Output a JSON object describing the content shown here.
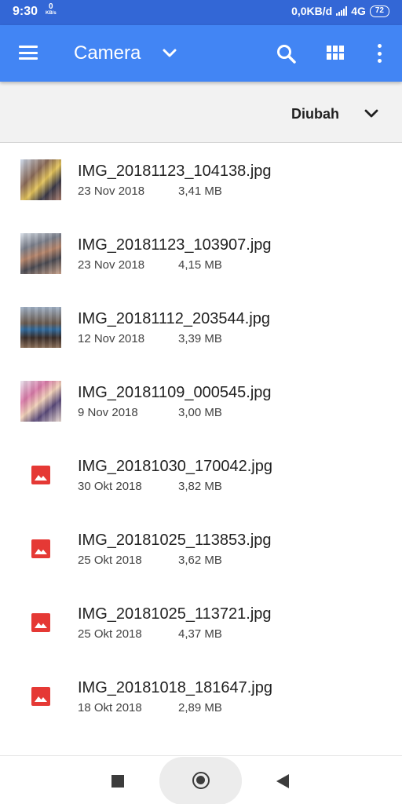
{
  "status_bar": {
    "time": "9:30",
    "speed_small_value": "0",
    "speed_small_unit": "KB/s",
    "network_speed": "0,0KB/d",
    "network_type": "4G",
    "battery": "72"
  },
  "app_bar": {
    "title": "Camera",
    "menu_icon": "hamburger-menu-icon",
    "dropdown_icon": "chevron-down-icon",
    "search_icon": "search-icon",
    "view_icon": "grid-view-icon",
    "more_icon": "more-vert-icon",
    "background_color": "#4285f4"
  },
  "sort_bar": {
    "label": "Diubah",
    "icon": "chevron-down-icon"
  },
  "files": [
    {
      "name": "IMG_20181123_104138.jpg",
      "date": "23 Nov 2018",
      "size": "3,41 MB",
      "thumbnail": "photo"
    },
    {
      "name": "IMG_20181123_103907.jpg",
      "date": "23 Nov 2018",
      "size": "4,15 MB",
      "thumbnail": "photo"
    },
    {
      "name": "IMG_20181112_203544.jpg",
      "date": "12 Nov 2018",
      "size": "3,39 MB",
      "thumbnail": "photo"
    },
    {
      "name": "IMG_20181109_000545.jpg",
      "date": "9 Nov 2018",
      "size": "3,00 MB",
      "thumbnail": "photo"
    },
    {
      "name": "IMG_20181030_170042.jpg",
      "date": "30 Okt 2018",
      "size": "3,82 MB",
      "thumbnail": "image-icon"
    },
    {
      "name": "IMG_20181025_113853.jpg",
      "date": "25 Okt 2018",
      "size": "3,62 MB",
      "thumbnail": "image-icon"
    },
    {
      "name": "IMG_20181025_113721.jpg",
      "date": "25 Okt 2018",
      "size": "4,37 MB",
      "thumbnail": "image-icon"
    },
    {
      "name": "IMG_20181018_181647.jpg",
      "date": "18 Okt 2018",
      "size": "2,89 MB",
      "thumbnail": "image-icon"
    }
  ],
  "image_icon_color": "#e53935",
  "nav_bar": {
    "recent_icon": "square-recents-icon",
    "home_icon": "circle-home-icon",
    "back_icon": "triangle-back-icon"
  }
}
